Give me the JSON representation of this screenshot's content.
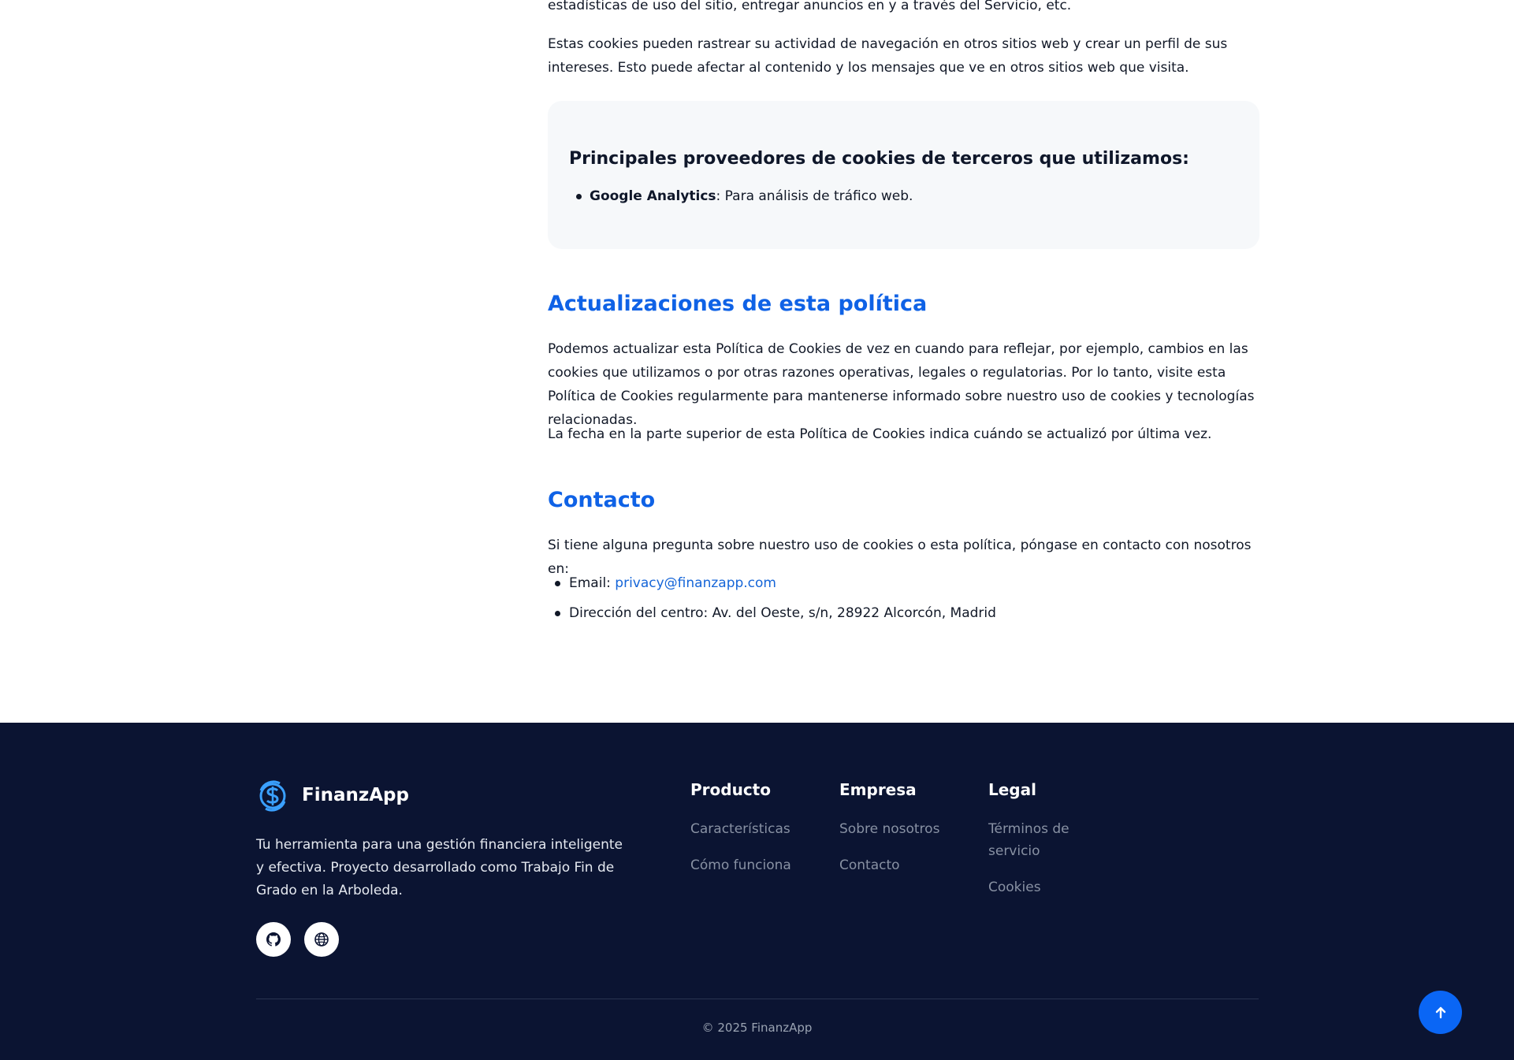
{
  "content": {
    "p_top_fragment": "estadísticas de uso del sitio, entregar anuncios en y a través del Servicio, etc.",
    "p_tracking": "Estas cookies pueden rastrear su actividad de navegación en otros sitios web y crear un perfil de sus intereses. Esto puede afectar al contenido y los mensajes que ve en otros sitios web que visita.",
    "providers_box": {
      "title": "Principales proveedores de cookies de terceros que utilizamos:",
      "items": [
        {
          "name": "Google Analytics",
          "desc": ": Para análisis de tráfico web."
        }
      ]
    },
    "updates": {
      "heading": "Actualizaciones de esta política",
      "p1": "Podemos actualizar esta Política de Cookies de vez en cuando para reflejar, por ejemplo, cambios en las cookies que utilizamos o por otras razones operativas, legales o regulatorias. Por lo tanto, visite esta Política de Cookies regularmente para mantenerse informado sobre nuestro uso de cookies y tecnologías relacionadas.",
      "p2": "La fecha en la parte superior de esta Política de Cookies indica cuándo se actualizó por última vez."
    },
    "contact": {
      "heading": "Contacto",
      "intro": "Si tiene alguna pregunta sobre nuestro uso de cookies o esta política, póngase en contacto con nosotros en:",
      "email_label": "Email: ",
      "email": "privacy@finanzapp.com",
      "address": "Dirección del centro: Av. del Oeste, s/n, 28922 Alcorcón, Madrid"
    }
  },
  "footer": {
    "brand": "FinanzApp",
    "description": "Tu herramienta para una gestión financiera inteligente y efectiva. Proyecto desarrollado como Trabajo Fin de Grado en la Arboleda.",
    "social": [
      {
        "icon": "github-icon"
      },
      {
        "icon": "globe-icon"
      }
    ],
    "columns": [
      {
        "title": "Producto",
        "links": [
          "Características",
          "Cómo funciona"
        ]
      },
      {
        "title": "Empresa",
        "links": [
          "Sobre nosotros",
          "Contacto"
        ]
      },
      {
        "title": "Legal",
        "links": [
          "Términos de servicio",
          "Cookies"
        ]
      }
    ],
    "copyright": "© 2025 FinanzApp"
  },
  "colors": {
    "accent": "#0f62e6",
    "footer_bg": "#0b1432",
    "scroll_top": "#0a66f5"
  },
  "scroll_top_icon": "arrow-up-icon"
}
